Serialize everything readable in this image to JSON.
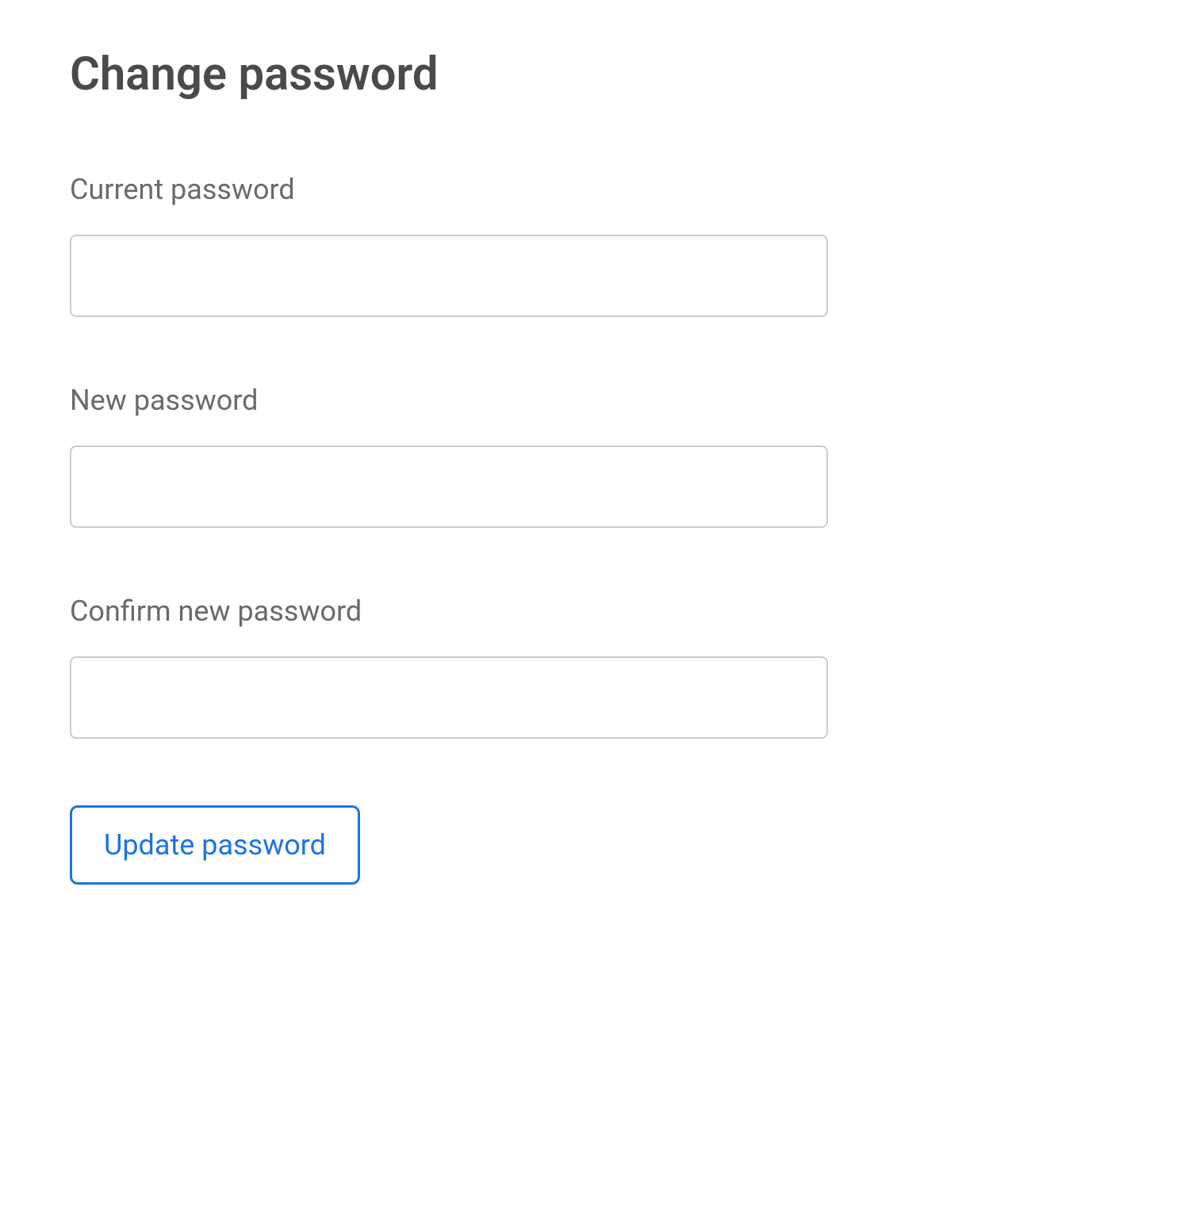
{
  "page": {
    "title": "Change password"
  },
  "form": {
    "fields": {
      "current_password": {
        "label": "Current password",
        "value": ""
      },
      "new_password": {
        "label": "New password",
        "value": ""
      },
      "confirm_password": {
        "label": "Confirm new password",
        "value": ""
      }
    },
    "submit_label": "Update password"
  }
}
